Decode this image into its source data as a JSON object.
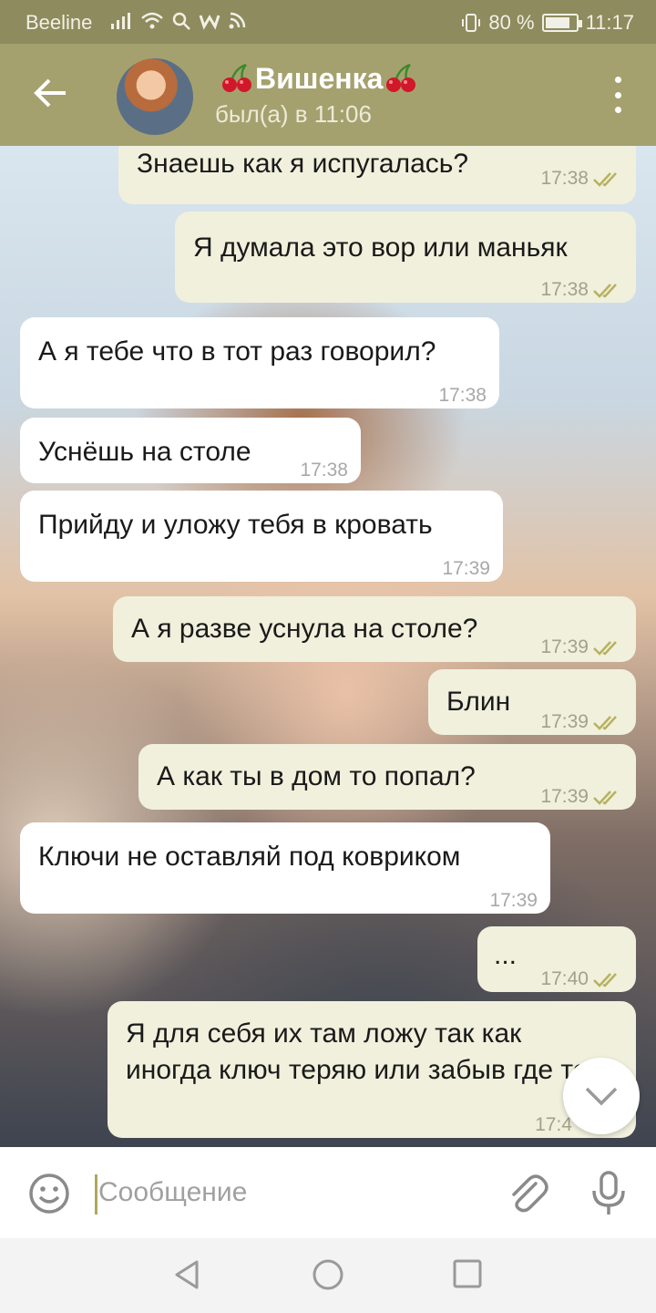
{
  "status_bar": {
    "carrier": "Beeline",
    "left_icons": [
      "signal-icon",
      "wifi-icon",
      "search-icon",
      "w-icon",
      "rss-icon"
    ],
    "battery_percent": "80 %",
    "battery_level": 0.8,
    "time": "11:17"
  },
  "header": {
    "contact_name": "Вишенка",
    "last_seen": "был(а) в 11:06",
    "icons": [
      "back-arrow-icon",
      "cherry-icon",
      "more-vertical-icon"
    ]
  },
  "messages": [
    {
      "dir": "out",
      "text": "Знаешь как я испугалась?",
      "time": "17:38",
      "read": true
    },
    {
      "dir": "out",
      "text": "Я думала это вор или маньяк",
      "time": "17:38",
      "read": true
    },
    {
      "dir": "in",
      "text": "А я тебе что в тот раз говорил?",
      "time": "17:38"
    },
    {
      "dir": "in",
      "text": "Уснёшь на столе",
      "time": "17:38"
    },
    {
      "dir": "in",
      "text": "Прийду и уложу тебя в кровать",
      "time": "17:39"
    },
    {
      "dir": "out",
      "text": "А я разве уснула на столе?",
      "time": "17:39",
      "read": true
    },
    {
      "dir": "out",
      "text": "Блин",
      "time": "17:39",
      "read": true
    },
    {
      "dir": "out",
      "text": "А как ты в дом то попал?",
      "time": "17:39",
      "read": true
    },
    {
      "dir": "in",
      "text": "Ключи не оставляй под ковриком",
      "time": "17:39"
    },
    {
      "dir": "out",
      "text": "...",
      "time": "17:40",
      "read": true
    },
    {
      "dir": "out",
      "text": "Я для себя их там ложу так как иногда ключ теряю или забыв где то",
      "time": "17:4",
      "read": true
    }
  ],
  "input": {
    "placeholder": "Сообщение",
    "value": ""
  },
  "colors": {
    "status_bar": "#8e8b5e",
    "header": "#a5a16e",
    "bubble_in": "#ffffff",
    "bubble_out": "#f0f0dd",
    "read_check": "#b8b15e"
  }
}
